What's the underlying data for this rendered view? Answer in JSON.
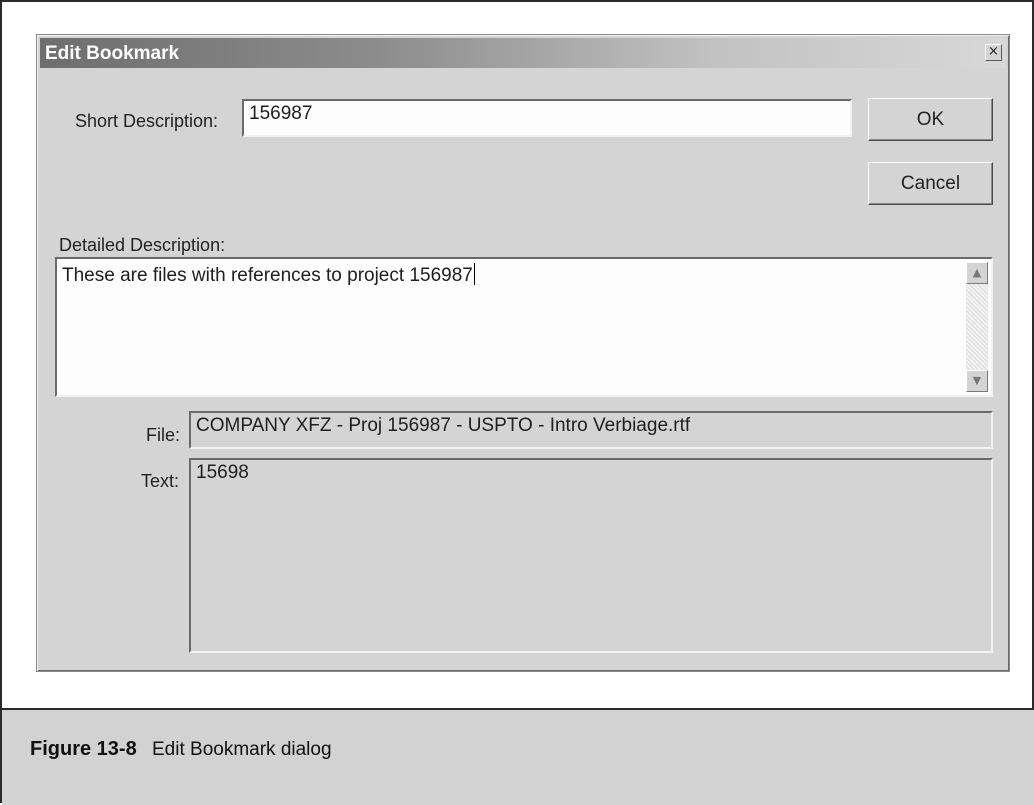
{
  "dialog": {
    "title": "Edit Bookmark",
    "close_glyph": "×",
    "short_description": {
      "label": "Short Description:",
      "value": "156987"
    },
    "buttons": {
      "ok": "OK",
      "cancel": "Cancel"
    },
    "detailed_description": {
      "label": "Detailed Description:",
      "value": "These are files with references to project 156987"
    },
    "file": {
      "label": "File:",
      "value": "COMPANY XFZ - Proj 156987 - USPTO - Intro Verbiage.rtf"
    },
    "text": {
      "label": "Text:",
      "value": "15698"
    },
    "icons": {
      "close": "close-icon",
      "scroll_up": "scroll-up-arrow-icon",
      "scroll_down": "scroll-down-arrow-icon"
    }
  },
  "caption": {
    "figure_number": "Figure 13-8",
    "figure_title": "Edit Bookmark dialog"
  }
}
